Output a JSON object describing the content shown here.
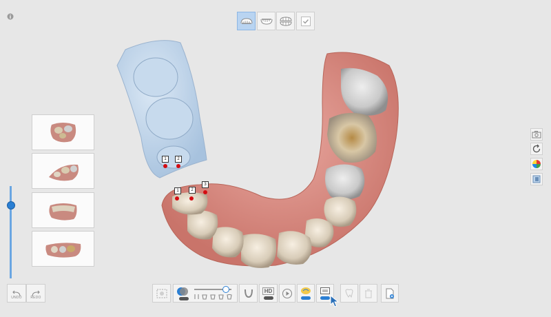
{
  "app": {
    "info_icon": "info-icon"
  },
  "top_toolbar": {
    "buttons": [
      {
        "name": "upper-jaw-scan",
        "icon": "upper-jaw-icon",
        "active": true
      },
      {
        "name": "lower-jaw-scan",
        "icon": "lower-jaw-icon",
        "active": false
      },
      {
        "name": "occlusion-scan",
        "icon": "occlusion-icon",
        "active": false
      },
      {
        "name": "complete",
        "icon": "check-icon",
        "active": false
      }
    ]
  },
  "alignment_markers": {
    "upper": [
      "1",
      "2"
    ],
    "lower": [
      "1",
      "2",
      "3"
    ]
  },
  "thumbnails": [
    {
      "name": "view-front"
    },
    {
      "name": "view-side"
    },
    {
      "name": "view-buccal"
    },
    {
      "name": "view-occlusal"
    }
  ],
  "undo_redo": {
    "undo_label": "UNDO",
    "redo_label": "REDO"
  },
  "right_toolbar": [
    {
      "name": "screenshot",
      "icon": "camera-icon"
    },
    {
      "name": "reset-view",
      "icon": "rotate-icon"
    },
    {
      "name": "color-map",
      "icon": "color-wheel-icon"
    },
    {
      "name": "display-mode",
      "icon": "layers-icon"
    }
  ],
  "bottom_toolbar": {
    "hd_label": "HD",
    "slider_position": 0.78
  },
  "colors": {
    "accent": "#2a7fd4",
    "active_button": "#b9d4f1",
    "marker": "#d40c12",
    "upper_model": "#bcd3ea"
  }
}
